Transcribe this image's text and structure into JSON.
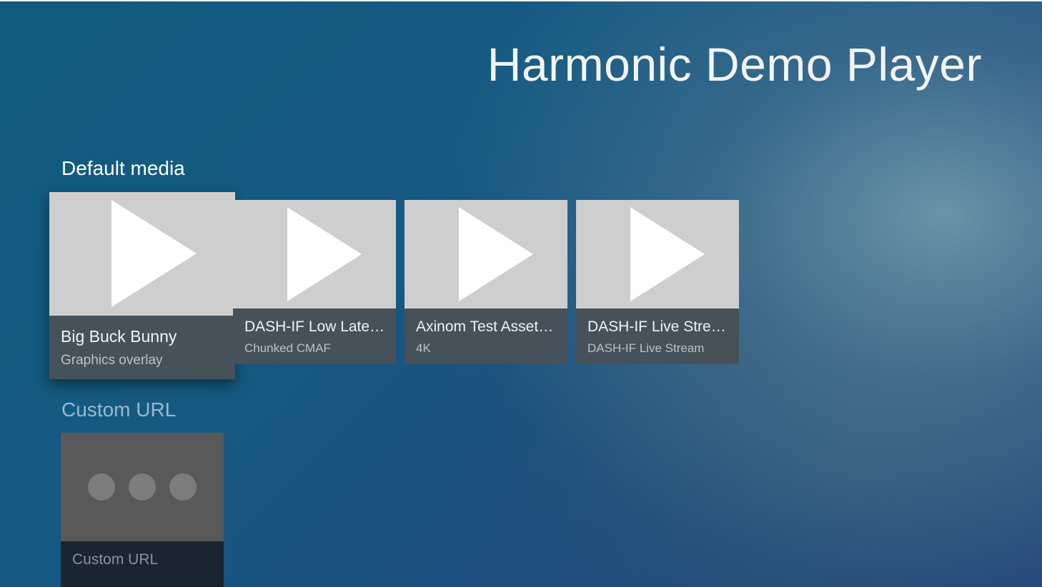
{
  "app": {
    "title": "Harmonic Demo Player"
  },
  "rows": {
    "default_media": {
      "header": "Default media",
      "cards": [
        {
          "title": "Big Buck Bunny",
          "subtitle": "Graphics overlay",
          "icon": "play-icon",
          "focused": true
        },
        {
          "title": "DASH-IF Low Latency...",
          "subtitle": "Chunked CMAF",
          "icon": "play-icon"
        },
        {
          "title": "Axinom Test Asset - T...",
          "subtitle": "4K",
          "icon": "play-icon"
        },
        {
          "title": "DASH-IF Live Stream",
          "subtitle": "DASH-IF Live Stream",
          "icon": "play-icon"
        }
      ]
    },
    "custom_url": {
      "header": "Custom URL",
      "cards": [
        {
          "title": "Custom URL",
          "icon": "more-dots-icon"
        }
      ]
    }
  },
  "colors": {
    "card_thumb": "#cfcecf",
    "card_info": "#475159",
    "custom_thumb": "#595959",
    "custom_info": "#1b2530"
  }
}
